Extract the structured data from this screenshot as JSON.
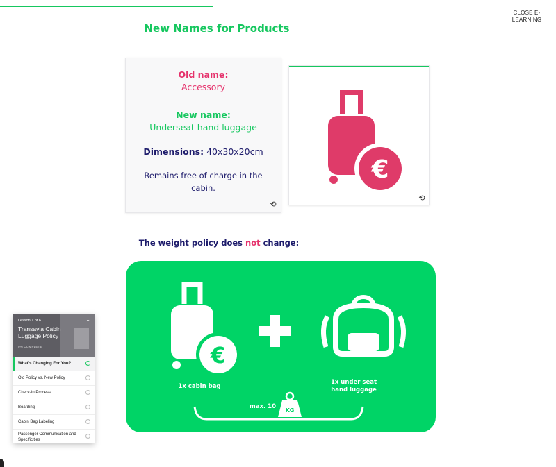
{
  "header": {
    "close_label": "CLOSE E-LEARNING"
  },
  "page": {
    "title": "New Names for Products"
  },
  "info_card": {
    "old_name_heading": "Old name:",
    "old_name_value": "Accessory",
    "new_name_heading": "New name:",
    "new_name_value": "Underseat hand luggage",
    "dimensions_heading": "Dimensions:",
    "dimensions_value": "40x30x20cm",
    "note": "Remains free of charge in the cabin."
  },
  "weight_section": {
    "subtitle_before": "The weight policy does ",
    "subtitle_highlight": "not",
    "subtitle_after": " change:",
    "cabin_bag_label": "1x cabin bag",
    "underseat_label": "1x under seat hand luggage",
    "max_label": "max. 10",
    "kg_label": "KG"
  },
  "lesson_menu": {
    "count": "Lesson 1 of 6",
    "title": "Transavia Cabin Luggage Policy",
    "progress": "0% COMPLETE",
    "items": [
      {
        "label": "What's Changing For You?"
      },
      {
        "label": "Old Policy vs. New Policy"
      },
      {
        "label": "Check-in Process"
      },
      {
        "label": "Boarding"
      },
      {
        "label": "Cabin Bag Labeling"
      },
      {
        "label": "Passenger Communication and Specificities"
      }
    ]
  },
  "colors": {
    "accent_green": "#16c75f",
    "panel_green": "#00d466",
    "pink": "#e5316b",
    "navy": "#1d1b6b"
  }
}
